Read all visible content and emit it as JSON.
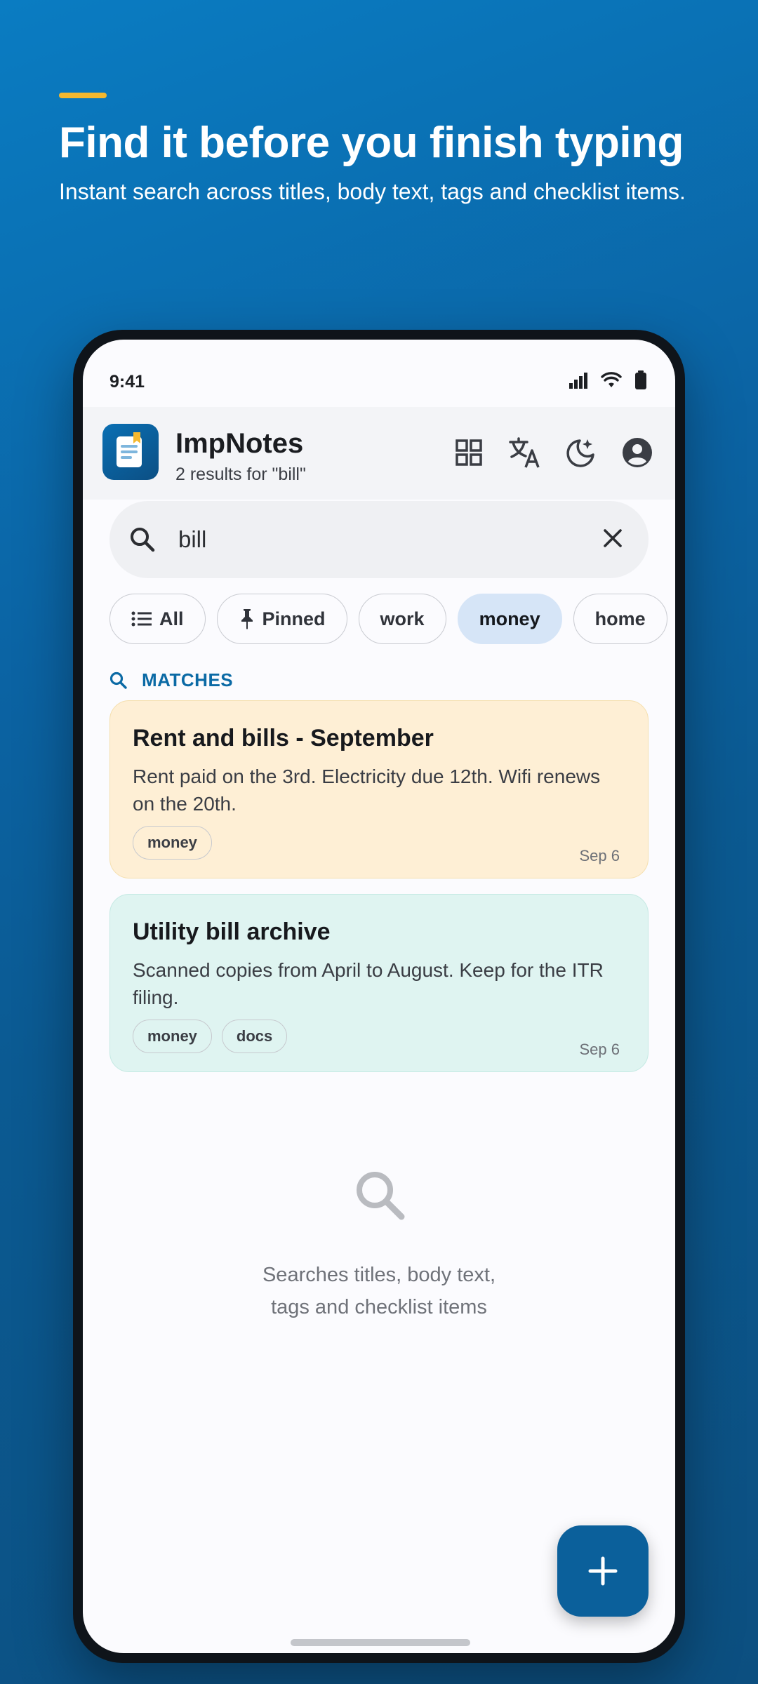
{
  "promo": {
    "headline": "Find it before you finish typing",
    "subheadline": "Instant search across titles, body text, tags and checklist items.",
    "accent_color": "#f5b82e"
  },
  "status_bar": {
    "time": "9:41",
    "icons": [
      "signal-icon",
      "wifi-icon",
      "battery-icon"
    ]
  },
  "header": {
    "app_name": "ImpNotes",
    "subtitle": "2 results for \"bill\"",
    "actions": [
      "grid-view-icon",
      "translate-icon",
      "dark-mode-icon",
      "account-icon"
    ]
  },
  "search": {
    "value": "bill",
    "icon": "search-icon",
    "clear_icon": "close-icon"
  },
  "filters": [
    {
      "label": "All",
      "icon": "list-icon",
      "selected": false
    },
    {
      "label": "Pinned",
      "icon": "pin-icon",
      "selected": false
    },
    {
      "label": "work",
      "selected": false
    },
    {
      "label": "money",
      "selected": true
    },
    {
      "label": "home",
      "selected": false
    }
  ],
  "section": {
    "label": "MATCHES"
  },
  "notes": [
    {
      "title": "Rent and bills - September",
      "body": "Rent paid on the 3rd. Electricity due 12th. Wifi renews on the 20th.",
      "tags": [
        "money"
      ],
      "date": "Sep 6",
      "color": "#feefd5"
    },
    {
      "title": "Utility bill archive",
      "body": "Scanned copies from April to August. Keep for the ITR filing.",
      "tags": [
        "money",
        "docs"
      ],
      "date": "Sep 6",
      "color": "#dff4f1"
    }
  ],
  "empty_hint": {
    "line1": "Searches titles, body text,",
    "line2": "tags and checklist items"
  },
  "colors": {
    "primary": "#0b609b",
    "chip_selected": "#d6e5f7",
    "section_label": "#0b6aa5"
  }
}
